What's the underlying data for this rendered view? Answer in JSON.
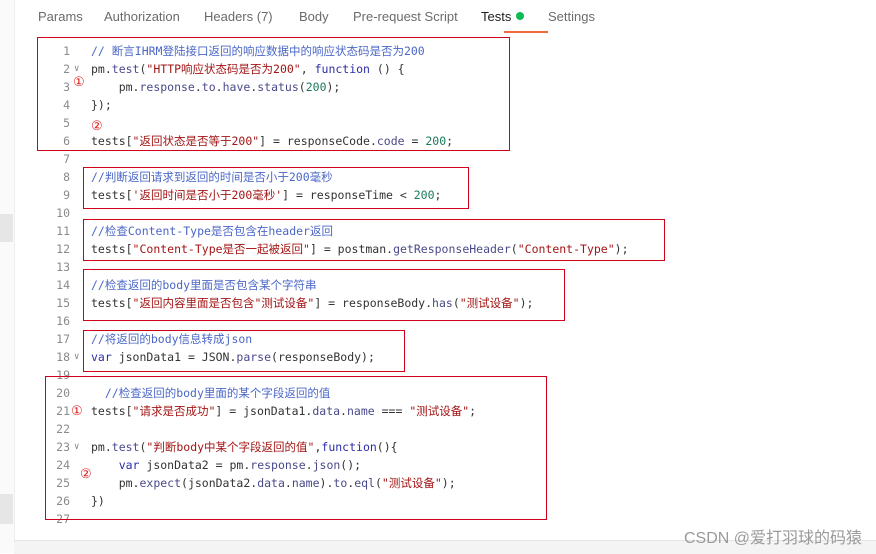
{
  "tabs": [
    {
      "label": "Params"
    },
    {
      "label": "Authorization"
    },
    {
      "label": "Headers (7)"
    },
    {
      "label": "Body"
    },
    {
      "label": "Pre-request Script"
    },
    {
      "label": "Tests"
    },
    {
      "label": "Settings"
    }
  ],
  "active_tab": "Tests",
  "colors": {
    "accent": "#f26b3a",
    "status_dot": "#0cbb52",
    "annotation": "#d0021b"
  },
  "lines": [
    {
      "n": "1",
      "tokens": [
        {
          "t": "// 断言IHRM登陆接口返回的响应数据中的响应状态码是否为200",
          "c": "com"
        }
      ]
    },
    {
      "n": "2",
      "fold": true,
      "tokens": [
        {
          "t": "pm.",
          "c": ""
        },
        {
          "t": "test",
          "c": "fn"
        },
        {
          "t": "(",
          "c": ""
        },
        {
          "t": "\"HTTP响应状态码是否为200\"",
          "c": "str"
        },
        {
          "t": ", ",
          "c": ""
        },
        {
          "t": "function",
          "c": "kw"
        },
        {
          "t": " () {",
          "c": ""
        }
      ]
    },
    {
      "n": "3",
      "tokens": [
        {
          "t": "    pm.",
          "c": ""
        },
        {
          "t": "response",
          "c": "fn"
        },
        {
          "t": ".",
          "c": ""
        },
        {
          "t": "to",
          "c": "fn"
        },
        {
          "t": ".",
          "c": ""
        },
        {
          "t": "have",
          "c": "fn"
        },
        {
          "t": ".",
          "c": ""
        },
        {
          "t": "status",
          "c": "fn"
        },
        {
          "t": "(",
          "c": ""
        },
        {
          "t": "200",
          "c": "num"
        },
        {
          "t": ");",
          "c": ""
        }
      ]
    },
    {
      "n": "4",
      "tokens": [
        {
          "t": "});",
          "c": ""
        }
      ]
    },
    {
      "n": "5",
      "tokens": []
    },
    {
      "n": "6",
      "tokens": [
        {
          "t": "tests[",
          "c": ""
        },
        {
          "t": "\"返回状态是否等于200\"",
          "c": "str"
        },
        {
          "t": "] = responseCode.",
          "c": ""
        },
        {
          "t": "code",
          "c": "fn"
        },
        {
          "t": " = ",
          "c": ""
        },
        {
          "t": "200",
          "c": "num"
        },
        {
          "t": ";",
          "c": ""
        }
      ]
    },
    {
      "n": "7",
      "tokens": []
    },
    {
      "n": "8",
      "tokens": [
        {
          "t": "//判断返回请求到返回的时间是否小于200毫秒",
          "c": "com"
        }
      ]
    },
    {
      "n": "9",
      "tokens": [
        {
          "t": "tests[",
          "c": ""
        },
        {
          "t": "'返回时间是否小于200毫秒'",
          "c": "str"
        },
        {
          "t": "] = responseTime < ",
          "c": ""
        },
        {
          "t": "200",
          "c": "num"
        },
        {
          "t": ";",
          "c": ""
        }
      ]
    },
    {
      "n": "10",
      "tokens": []
    },
    {
      "n": "11",
      "tokens": [
        {
          "t": "//检查Content-Type是否包含在header返回",
          "c": "com"
        }
      ]
    },
    {
      "n": "12",
      "tokens": [
        {
          "t": "tests[",
          "c": ""
        },
        {
          "t": "\"Content-Type是否一起被返回\"",
          "c": "str"
        },
        {
          "t": "] = postman.",
          "c": ""
        },
        {
          "t": "getResponseHeader",
          "c": "fn"
        },
        {
          "t": "(",
          "c": ""
        },
        {
          "t": "\"Content-Type\"",
          "c": "str"
        },
        {
          "t": ");",
          "c": ""
        }
      ]
    },
    {
      "n": "13",
      "tokens": []
    },
    {
      "n": "14",
      "tokens": [
        {
          "t": "//检查返回的body里面是否包含某个字符串",
          "c": "com"
        }
      ]
    },
    {
      "n": "15",
      "tokens": [
        {
          "t": "tests[",
          "c": ""
        },
        {
          "t": "\"返回内容里面是否包含\"测试设备\"",
          "c": "str"
        },
        {
          "t": "] = responseBody.",
          "c": ""
        },
        {
          "t": "has",
          "c": "fn"
        },
        {
          "t": "(",
          "c": ""
        },
        {
          "t": "\"测试设备\"",
          "c": "str"
        },
        {
          "t": ");",
          "c": ""
        }
      ]
    },
    {
      "n": "16",
      "tokens": []
    },
    {
      "n": "17",
      "tokens": [
        {
          "t": "//将返回的body信息转成json",
          "c": "com"
        }
      ]
    },
    {
      "n": "18",
      "fold": true,
      "tokens": [
        {
          "t": "var",
          "c": "kw"
        },
        {
          "t": " jsonData1 = JSON.",
          "c": ""
        },
        {
          "t": "parse",
          "c": "fn"
        },
        {
          "t": "(responseBody);",
          "c": ""
        }
      ]
    },
    {
      "n": "19",
      "tokens": []
    },
    {
      "n": "20",
      "tokens": [
        {
          "t": "  //检查返回的body里面的某个字段返回的值",
          "c": "com"
        }
      ]
    },
    {
      "n": "21",
      "tokens": [
        {
          "t": "tests[",
          "c": ""
        },
        {
          "t": "\"请求是否成功\"",
          "c": "str"
        },
        {
          "t": "] = jsonData1.",
          "c": ""
        },
        {
          "t": "data",
          "c": "fn"
        },
        {
          "t": ".",
          "c": ""
        },
        {
          "t": "name",
          "c": "fn"
        },
        {
          "t": " === ",
          "c": ""
        },
        {
          "t": "\"测试设备\"",
          "c": "str"
        },
        {
          "t": ";",
          "c": ""
        }
      ]
    },
    {
      "n": "22",
      "tokens": []
    },
    {
      "n": "23",
      "fold": true,
      "tokens": [
        {
          "t": "pm.",
          "c": ""
        },
        {
          "t": "test",
          "c": "fn"
        },
        {
          "t": "(",
          "c": ""
        },
        {
          "t": "\"判断body中某个字段返回的值\"",
          "c": "str"
        },
        {
          "t": ",",
          "c": ""
        },
        {
          "t": "function",
          "c": "kw"
        },
        {
          "t": "(){",
          "c": ""
        }
      ]
    },
    {
      "n": "24",
      "tokens": [
        {
          "t": "    ",
          "c": ""
        },
        {
          "t": "var",
          "c": "kw"
        },
        {
          "t": " jsonData2 = pm.",
          "c": ""
        },
        {
          "t": "response",
          "c": "fn"
        },
        {
          "t": ".",
          "c": ""
        },
        {
          "t": "json",
          "c": "fn"
        },
        {
          "t": "();",
          "c": ""
        }
      ]
    },
    {
      "n": "25",
      "tokens": [
        {
          "t": "    pm.",
          "c": ""
        },
        {
          "t": "expect",
          "c": "fn"
        },
        {
          "t": "(jsonData2.",
          "c": ""
        },
        {
          "t": "data",
          "c": "fn"
        },
        {
          "t": ".",
          "c": ""
        },
        {
          "t": "name",
          "c": "fn"
        },
        {
          "t": ").",
          "c": ""
        },
        {
          "t": "to",
          "c": "fn"
        },
        {
          "t": ".",
          "c": ""
        },
        {
          "t": "eql",
          "c": "fn"
        },
        {
          "t": "(",
          "c": ""
        },
        {
          "t": "\"测试设备\"",
          "c": "str"
        },
        {
          "t": ");",
          "c": ""
        }
      ]
    },
    {
      "n": "26",
      "tokens": [
        {
          "t": "})",
          "c": ""
        }
      ]
    },
    {
      "n": "27",
      "tokens": []
    }
  ],
  "badges": [
    {
      "text": "①"
    },
    {
      "text": "②"
    },
    {
      "text": "①"
    },
    {
      "text": "②"
    }
  ],
  "watermark": "CSDN @爱打羽球的码猿"
}
